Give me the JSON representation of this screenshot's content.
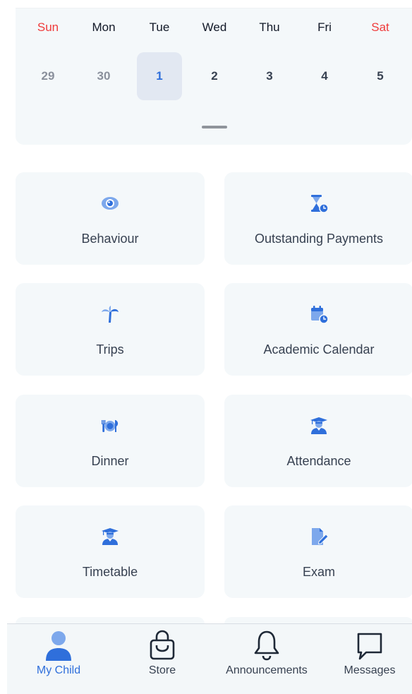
{
  "calendar": {
    "weekdays": [
      "Sun",
      "Mon",
      "Tue",
      "Wed",
      "Thu",
      "Fri",
      "Sat"
    ],
    "dates": [
      "29",
      "30",
      "1",
      "2",
      "3",
      "4",
      "5"
    ],
    "selected_date": "1"
  },
  "tiles": [
    {
      "label": "Behaviour",
      "icon": "eye-icon"
    },
    {
      "label": "Outstanding Payments",
      "icon": "hourglass-clock-icon"
    },
    {
      "label": "Trips",
      "icon": "palm-tree-icon"
    },
    {
      "label": "Academic Calendar",
      "icon": "calendar-clock-icon"
    },
    {
      "label": "Dinner",
      "icon": "plate-cutlery-icon"
    },
    {
      "label": "Attendance",
      "icon": "graduate-icon"
    },
    {
      "label": "Timetable",
      "icon": "graduate-icon"
    },
    {
      "label": "Exam",
      "icon": "document-edit-icon"
    }
  ],
  "tabbar": {
    "items": [
      {
        "label": "My Child",
        "icon": "person-icon",
        "active": true
      },
      {
        "label": "Store",
        "icon": "shopping-bag-icon",
        "active": false
      },
      {
        "label": "Announcements",
        "icon": "bell-icon",
        "active": false
      },
      {
        "label": "Messages",
        "icon": "chat-bubble-icon",
        "active": false
      }
    ]
  },
  "colors": {
    "accent": "#2f6fdb",
    "weekend": "#ef3b3b",
    "card_bg": "#f4f8fa",
    "selected_bg": "#e2e8f2"
  }
}
